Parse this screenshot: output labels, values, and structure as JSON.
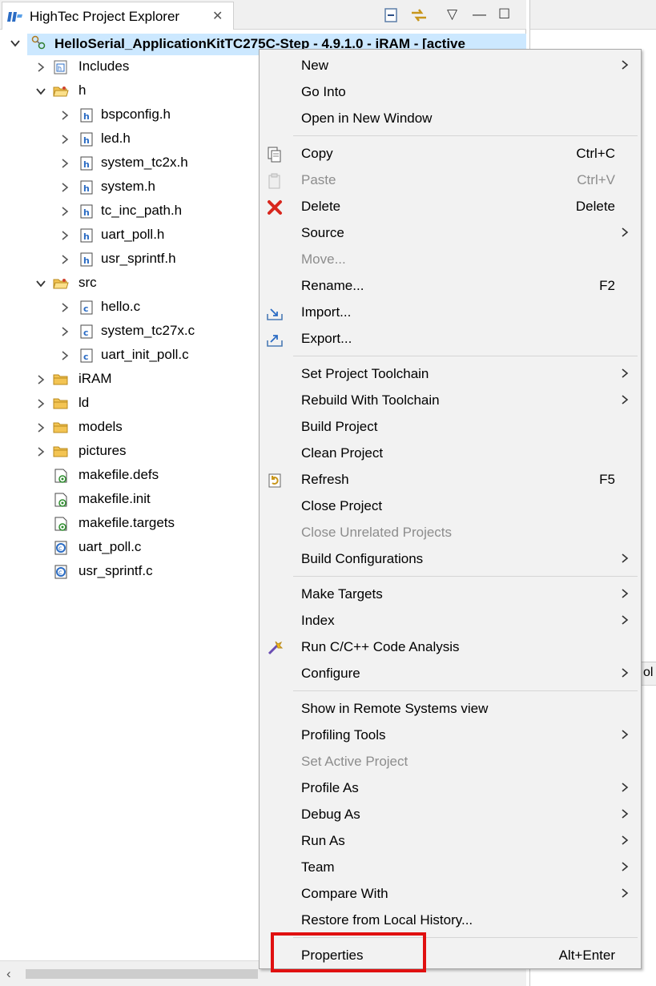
{
  "view_tab": {
    "title": "HighTec Project Explorer",
    "close_glyph": "✕"
  },
  "toolbar": {
    "collapse_icon": "collapse-all-icon",
    "link_icon": "link-editor-icon",
    "menu_glyph": "▽",
    "minimize_glyph": "—",
    "maximize_glyph": "☐"
  },
  "tree": {
    "root_label": "HelloSerial_ApplicationKitTC275C-Step - 4.9.1.0 -  iRAM - [active",
    "items": [
      {
        "label": "Includes",
        "icon": "includes-icon",
        "level": 1,
        "chevron": "right"
      },
      {
        "label": "h",
        "icon": "open-folder-icon",
        "level": 1,
        "chevron": "down"
      },
      {
        "label": "bspconfig.h",
        "icon": "header-file-icon",
        "level": 2,
        "chevron": "right"
      },
      {
        "label": "led.h",
        "icon": "header-file-icon",
        "level": 2,
        "chevron": "right"
      },
      {
        "label": "system_tc2x.h",
        "icon": "header-file-icon",
        "level": 2,
        "chevron": "right"
      },
      {
        "label": "system.h",
        "icon": "header-file-icon",
        "level": 2,
        "chevron": "right"
      },
      {
        "label": "tc_inc_path.h",
        "icon": "header-file-icon",
        "level": 2,
        "chevron": "right"
      },
      {
        "label": "uart_poll.h",
        "icon": "header-file-icon",
        "level": 2,
        "chevron": "right"
      },
      {
        "label": "usr_sprintf.h",
        "icon": "header-file-icon",
        "level": 2,
        "chevron": "right"
      },
      {
        "label": "src",
        "icon": "open-folder-icon",
        "level": 1,
        "chevron": "down"
      },
      {
        "label": "hello.c",
        "icon": "c-file-icon",
        "level": 2,
        "chevron": "right"
      },
      {
        "label": "system_tc27x.c",
        "icon": "c-file-icon",
        "level": 2,
        "chevron": "right"
      },
      {
        "label": "uart_init_poll.c",
        "icon": "c-file-icon",
        "level": 2,
        "chevron": "right"
      },
      {
        "label": "iRAM",
        "icon": "folder-icon",
        "level": 1,
        "chevron": "right"
      },
      {
        "label": "ld",
        "icon": "folder-icon",
        "level": 1,
        "chevron": "right"
      },
      {
        "label": "models",
        "icon": "folder-icon",
        "level": 1,
        "chevron": "right"
      },
      {
        "label": "pictures",
        "icon": "folder-icon",
        "level": 1,
        "chevron": "right"
      },
      {
        "label": "makefile.defs",
        "icon": "makefile-icon",
        "level": 1,
        "chevron": "none"
      },
      {
        "label": "makefile.init",
        "icon": "makefile-icon",
        "level": 1,
        "chevron": "none"
      },
      {
        "label": "makefile.targets",
        "icon": "makefile-icon",
        "level": 1,
        "chevron": "none"
      },
      {
        "label": "uart_poll.c",
        "icon": "c-source-icon",
        "level": 1,
        "chevron": "none"
      },
      {
        "label": "usr_sprintf.c",
        "icon": "c-source-icon",
        "level": 1,
        "chevron": "none"
      }
    ]
  },
  "context_menu": {
    "items": [
      {
        "label": "New",
        "shortcut": "",
        "submenu": true,
        "enabled": true,
        "icon": ""
      },
      {
        "label": "Go Into",
        "shortcut": "",
        "submenu": false,
        "enabled": true,
        "icon": ""
      },
      {
        "label": "Open in New Window",
        "shortcut": "",
        "submenu": false,
        "enabled": true,
        "icon": ""
      },
      {
        "separator": true
      },
      {
        "label": "Copy",
        "shortcut": "Ctrl+C",
        "submenu": false,
        "enabled": true,
        "icon": "copy-icon"
      },
      {
        "label": "Paste",
        "shortcut": "Ctrl+V",
        "submenu": false,
        "enabled": false,
        "icon": "paste-icon"
      },
      {
        "label": "Delete",
        "shortcut": "Delete",
        "submenu": false,
        "enabled": true,
        "icon": "delete-icon"
      },
      {
        "label": "Source",
        "shortcut": "",
        "submenu": true,
        "enabled": true,
        "icon": ""
      },
      {
        "label": "Move...",
        "shortcut": "",
        "submenu": false,
        "enabled": false,
        "icon": ""
      },
      {
        "label": "Rename...",
        "shortcut": "F2",
        "submenu": false,
        "enabled": true,
        "icon": ""
      },
      {
        "label": "Import...",
        "shortcut": "",
        "submenu": false,
        "enabled": true,
        "icon": "import-icon"
      },
      {
        "label": "Export...",
        "shortcut": "",
        "submenu": false,
        "enabled": true,
        "icon": "export-icon"
      },
      {
        "separator": true
      },
      {
        "label": "Set Project Toolchain",
        "shortcut": "",
        "submenu": true,
        "enabled": true,
        "icon": ""
      },
      {
        "label": "Rebuild With Toolchain",
        "shortcut": "",
        "submenu": true,
        "enabled": true,
        "icon": ""
      },
      {
        "label": "Build Project",
        "shortcut": "",
        "submenu": false,
        "enabled": true,
        "icon": ""
      },
      {
        "label": "Clean Project",
        "shortcut": "",
        "submenu": false,
        "enabled": true,
        "icon": ""
      },
      {
        "label": "Refresh",
        "shortcut": "F5",
        "submenu": false,
        "enabled": true,
        "icon": "refresh-icon"
      },
      {
        "label": "Close Project",
        "shortcut": "",
        "submenu": false,
        "enabled": true,
        "icon": ""
      },
      {
        "label": "Close Unrelated Projects",
        "shortcut": "",
        "submenu": false,
        "enabled": false,
        "icon": ""
      },
      {
        "label": "Build Configurations",
        "shortcut": "",
        "submenu": true,
        "enabled": true,
        "icon": ""
      },
      {
        "separator": true
      },
      {
        "label": "Make Targets",
        "shortcut": "",
        "submenu": true,
        "enabled": true,
        "icon": ""
      },
      {
        "label": "Index",
        "shortcut": "",
        "submenu": true,
        "enabled": true,
        "icon": ""
      },
      {
        "label": "Run C/C++ Code Analysis",
        "shortcut": "",
        "submenu": false,
        "enabled": true,
        "icon": "code-analysis-icon"
      },
      {
        "label": "Configure",
        "shortcut": "",
        "submenu": true,
        "enabled": true,
        "icon": ""
      },
      {
        "separator": true
      },
      {
        "label": "Show in Remote Systems view",
        "shortcut": "",
        "submenu": false,
        "enabled": true,
        "icon": ""
      },
      {
        "label": "Profiling Tools",
        "shortcut": "",
        "submenu": true,
        "enabled": true,
        "icon": ""
      },
      {
        "label": "Set Active Project",
        "shortcut": "",
        "submenu": false,
        "enabled": false,
        "icon": ""
      },
      {
        "label": "Profile As",
        "shortcut": "",
        "submenu": true,
        "enabled": true,
        "icon": ""
      },
      {
        "label": "Debug As",
        "shortcut": "",
        "submenu": true,
        "enabled": true,
        "icon": ""
      },
      {
        "label": "Run As",
        "shortcut": "",
        "submenu": true,
        "enabled": true,
        "icon": ""
      },
      {
        "label": "Team",
        "shortcut": "",
        "submenu": true,
        "enabled": true,
        "icon": ""
      },
      {
        "label": "Compare With",
        "shortcut": "",
        "submenu": true,
        "enabled": true,
        "icon": ""
      },
      {
        "label": "Restore from Local History...",
        "shortcut": "",
        "submenu": false,
        "enabled": true,
        "icon": ""
      },
      {
        "separator": true
      },
      {
        "label": "Properties",
        "shortcut": "Alt+Enter",
        "submenu": false,
        "enabled": true,
        "icon": "",
        "highlighted": true
      }
    ]
  },
  "colors": {
    "selection": "#cce8ff",
    "menu_bg": "#f2f2f2",
    "disabled_text": "#8d8d8d",
    "highlight_border": "#e01010"
  },
  "right_strip": {
    "partial_text": "ol"
  }
}
